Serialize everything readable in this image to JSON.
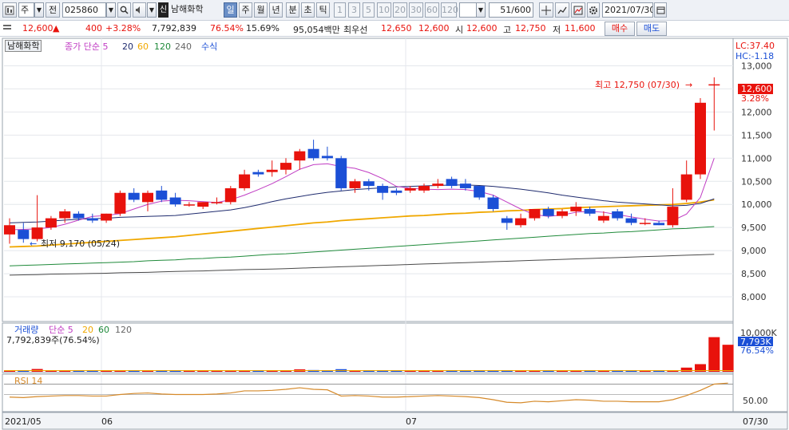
{
  "toolbar": {
    "market": "주",
    "prev_label": "전",
    "code": "025860",
    "badge": "신",
    "name": "남해화학",
    "periods": [
      "일",
      "주",
      "월",
      "년",
      "분",
      "초",
      "틱"
    ],
    "active_period": "일",
    "intervals": [
      "1",
      "3",
      "5",
      "10",
      "20",
      "30",
      "60",
      "120"
    ],
    "count": "51/600",
    "date": "2021/07/30"
  },
  "quote": {
    "price": "12,600",
    "change": "400",
    "change_pct": "+3.28%",
    "volume": "7,792,839",
    "vol_ratio": "76.54%",
    "turnover": "15.69%",
    "amount": "95,054백만",
    "best_label": "최우선",
    "best_ask": "12,650",
    "best_bid": "12,600",
    "open_label": "시",
    "open": "12,600",
    "high_label": "고",
    "high": "12,750",
    "low_label": "저",
    "low": "11,600",
    "buy_label": "매수",
    "sell_label": "매도"
  },
  "legend": {
    "name_chip": "남해화학",
    "ma_title": "종가 단순 5",
    "ma20": "20",
    "ma60": "60",
    "ma120": "120",
    "ma240": "240",
    "formula": "수식",
    "lc": "LC:37.40",
    "hc": "HC:-1.18"
  },
  "annotations": {
    "high": "최고 12,750 (07/30)",
    "low": "최저 9,170 (05/24)",
    "last_price": "12,600",
    "last_pct": "3.28%"
  },
  "volume_panel": {
    "title": "거래량",
    "ma_label": "단순 5",
    "ma20": "20",
    "ma60": "60",
    "ma120": "120",
    "info": "7,792,839주(76.54%)",
    "axis_top": "10,000K",
    "last_vol": "7,793K",
    "last_pct": "76.54%"
  },
  "rsi_panel": {
    "title": "RSI 14",
    "level": "50.00"
  },
  "x_axis": {
    "labels": [
      "2021/05",
      "06",
      "07"
    ],
    "end": "07/30"
  },
  "colors": {
    "up": "#e8120c",
    "down": "#1b4fd6",
    "ma5": "#c03cc3",
    "ma20": "#1f2b6e",
    "ma60": "#f0a800",
    "ma120": "#1f8a3a",
    "ma240": "#4a4a4a",
    "rsi": "#d68a2a"
  },
  "chart_data": {
    "type": "candlestick",
    "y_axis_ticks": [
      8000,
      8500,
      9000,
      9500,
      10000,
      10500,
      11000,
      11500,
      12000,
      12500,
      13000
    ],
    "ylim": [
      7500,
      13250
    ],
    "candles": [
      {
        "o": 9350,
        "h": 9700,
        "l": 9150,
        "c": 9550
      },
      {
        "o": 9450,
        "h": 9600,
        "l": 9170,
        "c": 9250
      },
      {
        "o": 9250,
        "h": 10200,
        "l": 9200,
        "c": 9500
      },
      {
        "o": 9500,
        "h": 9750,
        "l": 9450,
        "c": 9700
      },
      {
        "o": 9700,
        "h": 9900,
        "l": 9600,
        "c": 9850
      },
      {
        "o": 9800,
        "h": 9850,
        "l": 9650,
        "c": 9700
      },
      {
        "o": 9700,
        "h": 9800,
        "l": 9600,
        "c": 9650
      },
      {
        "o": 9650,
        "h": 9800,
        "l": 9600,
        "c": 9800
      },
      {
        "o": 9800,
        "h": 10300,
        "l": 9750,
        "c": 10250
      },
      {
        "o": 10250,
        "h": 10350,
        "l": 10050,
        "c": 10100
      },
      {
        "o": 10050,
        "h": 10300,
        "l": 9850,
        "c": 10250
      },
      {
        "o": 10300,
        "h": 10400,
        "l": 10050,
        "c": 10100
      },
      {
        "o": 10150,
        "h": 10250,
        "l": 9950,
        "c": 10000
      },
      {
        "o": 10000,
        "h": 10050,
        "l": 9950,
        "c": 10000
      },
      {
        "o": 9950,
        "h": 10050,
        "l": 9900,
        "c": 10050
      },
      {
        "o": 10050,
        "h": 10150,
        "l": 10000,
        "c": 10050
      },
      {
        "o": 10050,
        "h": 10400,
        "l": 10000,
        "c": 10350
      },
      {
        "o": 10350,
        "h": 10750,
        "l": 10300,
        "c": 10650
      },
      {
        "o": 10700,
        "h": 10750,
        "l": 10600,
        "c": 10650
      },
      {
        "o": 10700,
        "h": 10950,
        "l": 10600,
        "c": 10750
      },
      {
        "o": 10750,
        "h": 11000,
        "l": 10650,
        "c": 10900
      },
      {
        "o": 10950,
        "h": 11200,
        "l": 10750,
        "c": 11150
      },
      {
        "o": 11200,
        "h": 11400,
        "l": 10950,
        "c": 11000
      },
      {
        "o": 11050,
        "h": 11250,
        "l": 10950,
        "c": 11000
      },
      {
        "o": 11000,
        "h": 11050,
        "l": 10300,
        "c": 10350
      },
      {
        "o": 10350,
        "h": 10550,
        "l": 10250,
        "c": 10500
      },
      {
        "o": 10500,
        "h": 10550,
        "l": 10300,
        "c": 10400
      },
      {
        "o": 10400,
        "h": 10450,
        "l": 10100,
        "c": 10250
      },
      {
        "o": 10300,
        "h": 10350,
        "l": 10200,
        "c": 10250
      },
      {
        "o": 10300,
        "h": 10400,
        "l": 10250,
        "c": 10350
      },
      {
        "o": 10300,
        "h": 10450,
        "l": 10250,
        "c": 10400
      },
      {
        "o": 10400,
        "h": 10550,
        "l": 10350,
        "c": 10450
      },
      {
        "o": 10550,
        "h": 10600,
        "l": 10350,
        "c": 10400
      },
      {
        "o": 10450,
        "h": 10550,
        "l": 10300,
        "c": 10350
      },
      {
        "o": 10400,
        "h": 10400,
        "l": 10100,
        "c": 10150
      },
      {
        "o": 10150,
        "h": 10200,
        "l": 9850,
        "c": 9900
      },
      {
        "o": 9700,
        "h": 9750,
        "l": 9450,
        "c": 9600
      },
      {
        "o": 9550,
        "h": 9800,
        "l": 9500,
        "c": 9700
      },
      {
        "o": 9700,
        "h": 9900,
        "l": 9650,
        "c": 9900
      },
      {
        "o": 9900,
        "h": 9950,
        "l": 9700,
        "c": 9750
      },
      {
        "o": 9750,
        "h": 9900,
        "l": 9700,
        "c": 9850
      },
      {
        "o": 9850,
        "h": 10050,
        "l": 9750,
        "c": 9950
      },
      {
        "o": 9900,
        "h": 9950,
        "l": 9750,
        "c": 9800
      },
      {
        "o": 9650,
        "h": 9850,
        "l": 9600,
        "c": 9750
      },
      {
        "o": 9850,
        "h": 9900,
        "l": 9650,
        "c": 9700
      },
      {
        "o": 9700,
        "h": 9800,
        "l": 9550,
        "c": 9600
      },
      {
        "o": 9600,
        "h": 9700,
        "l": 9550,
        "c": 9600
      },
      {
        "o": 9600,
        "h": 9650,
        "l": 9550,
        "c": 9550
      },
      {
        "o": 9550,
        "h": 10350,
        "l": 9500,
        "c": 9950
      },
      {
        "o": 10100,
        "h": 10950,
        "l": 10050,
        "c": 10650
      },
      {
        "o": 10650,
        "h": 12300,
        "l": 10550,
        "c": 12200
      }
    ],
    "last_candle": {
      "o": 12600,
      "h": 12750,
      "l": 11600,
      "c": 12600
    },
    "ma5": [
      9450,
      9460,
      9470,
      9500,
      9570,
      9660,
      9740,
      9760,
      9800,
      9900,
      10000,
      10070,
      10090,
      10080,
      10060,
      10040,
      10100,
      10200,
      10320,
      10450,
      10600,
      10760,
      10860,
      10880,
      10820,
      10780,
      10690,
      10560,
      10390,
      10350,
      10330,
      10320,
      10330,
      10320,
      10280,
      10200,
      10050,
      9900,
      9780,
      9740,
      9770,
      9830,
      9850,
      9830,
      9780,
      9730,
      9680,
      9640,
      9650,
      9790,
      10150,
      11000
    ],
    "ma20": [
      9600,
      9610,
      9620,
      9640,
      9660,
      9680,
      9690,
      9700,
      9720,
      9730,
      9740,
      9750,
      9760,
      9790,
      9820,
      9850,
      9880,
      9930,
      9990,
      10060,
      10120,
      10170,
      10220,
      10260,
      10290,
      10320,
      10340,
      10360,
      10380,
      10390,
      10400,
      10410,
      10420,
      10420,
      10410,
      10390,
      10360,
      10330,
      10290,
      10250,
      10200,
      10160,
      10120,
      10080,
      10050,
      10030,
      10010,
      9990,
      9970,
      9980,
      10020,
      10120
    ],
    "ma60": [
      9080,
      9090,
      9100,
      9120,
      9140,
      9160,
      9180,
      9200,
      9220,
      9240,
      9260,
      9280,
      9300,
      9330,
      9360,
      9390,
      9420,
      9450,
      9480,
      9510,
      9540,
      9570,
      9600,
      9620,
      9650,
      9670,
      9690,
      9710,
      9730,
      9750,
      9760,
      9780,
      9800,
      9810,
      9830,
      9840,
      9860,
      9870,
      9890,
      9900,
      9910,
      9930,
      9940,
      9950,
      9960,
      9970,
      9980,
      9990,
      10000,
      10020,
      10050,
      10100
    ],
    "ma120": [
      8670,
      8680,
      8690,
      8700,
      8710,
      8720,
      8730,
      8740,
      8750,
      8760,
      8780,
      8790,
      8800,
      8820,
      8830,
      8850,
      8860,
      8880,
      8900,
      8920,
      8930,
      8950,
      8970,
      8990,
      9010,
      9030,
      9050,
      9070,
      9090,
      9110,
      9130,
      9150,
      9170,
      9190,
      9210,
      9230,
      9250,
      9270,
      9290,
      9310,
      9330,
      9350,
      9370,
      9380,
      9400,
      9410,
      9430,
      9450,
      9470,
      9480,
      9500,
      9520
    ],
    "ma240": [
      8470,
      8475,
      8480,
      8490,
      8495,
      8500,
      8505,
      8510,
      8520,
      8525,
      8530,
      8540,
      8550,
      8555,
      8560,
      8570,
      8580,
      8590,
      8595,
      8600,
      8610,
      8620,
      8630,
      8640,
      8650,
      8660,
      8670,
      8680,
      8690,
      8700,
      8710,
      8720,
      8730,
      8740,
      8750,
      8760,
      8770,
      8780,
      8790,
      8800,
      8810,
      8820,
      8830,
      8840,
      8850,
      8860,
      8870,
      8880,
      8890,
      8900,
      8910,
      8920
    ],
    "volume": [
      0.35,
      0.35,
      0.8,
      0.35,
      0.3,
      0.35,
      0.3,
      0.3,
      0.35,
      0.35,
      0.4,
      0.35,
      0.3,
      0.3,
      0.3,
      0.3,
      0.35,
      0.45,
      0.4,
      0.35,
      0.45,
      0.7,
      0.5,
      0.4,
      0.75,
      0.35,
      0.35,
      0.3,
      0.3,
      0.3,
      0.3,
      0.35,
      0.3,
      0.3,
      0.3,
      0.3,
      0.3,
      0.3,
      0.3,
      0.3,
      0.3,
      0.3,
      0.3,
      0.3,
      0.3,
      0.3,
      0.3,
      0.3,
      0.3,
      1.2,
      2.2,
      10.0,
      7.8
    ],
    "volume_ylim": [
      0,
      10.6
    ],
    "rsi": [
      45,
      44,
      46,
      47,
      48,
      48,
      47,
      47,
      50,
      52,
      53,
      51,
      50,
      50,
      50,
      51,
      53,
      57,
      57,
      58,
      60,
      63,
      60,
      59,
      47,
      48,
      47,
      45,
      45,
      46,
      47,
      48,
      47,
      46,
      44,
      40,
      35,
      34,
      37,
      36,
      38,
      40,
      39,
      37,
      37,
      36,
      36,
      36,
      40,
      48,
      58,
      70,
      72
    ],
    "rsi_ylim": [
      20,
      80
    ]
  }
}
